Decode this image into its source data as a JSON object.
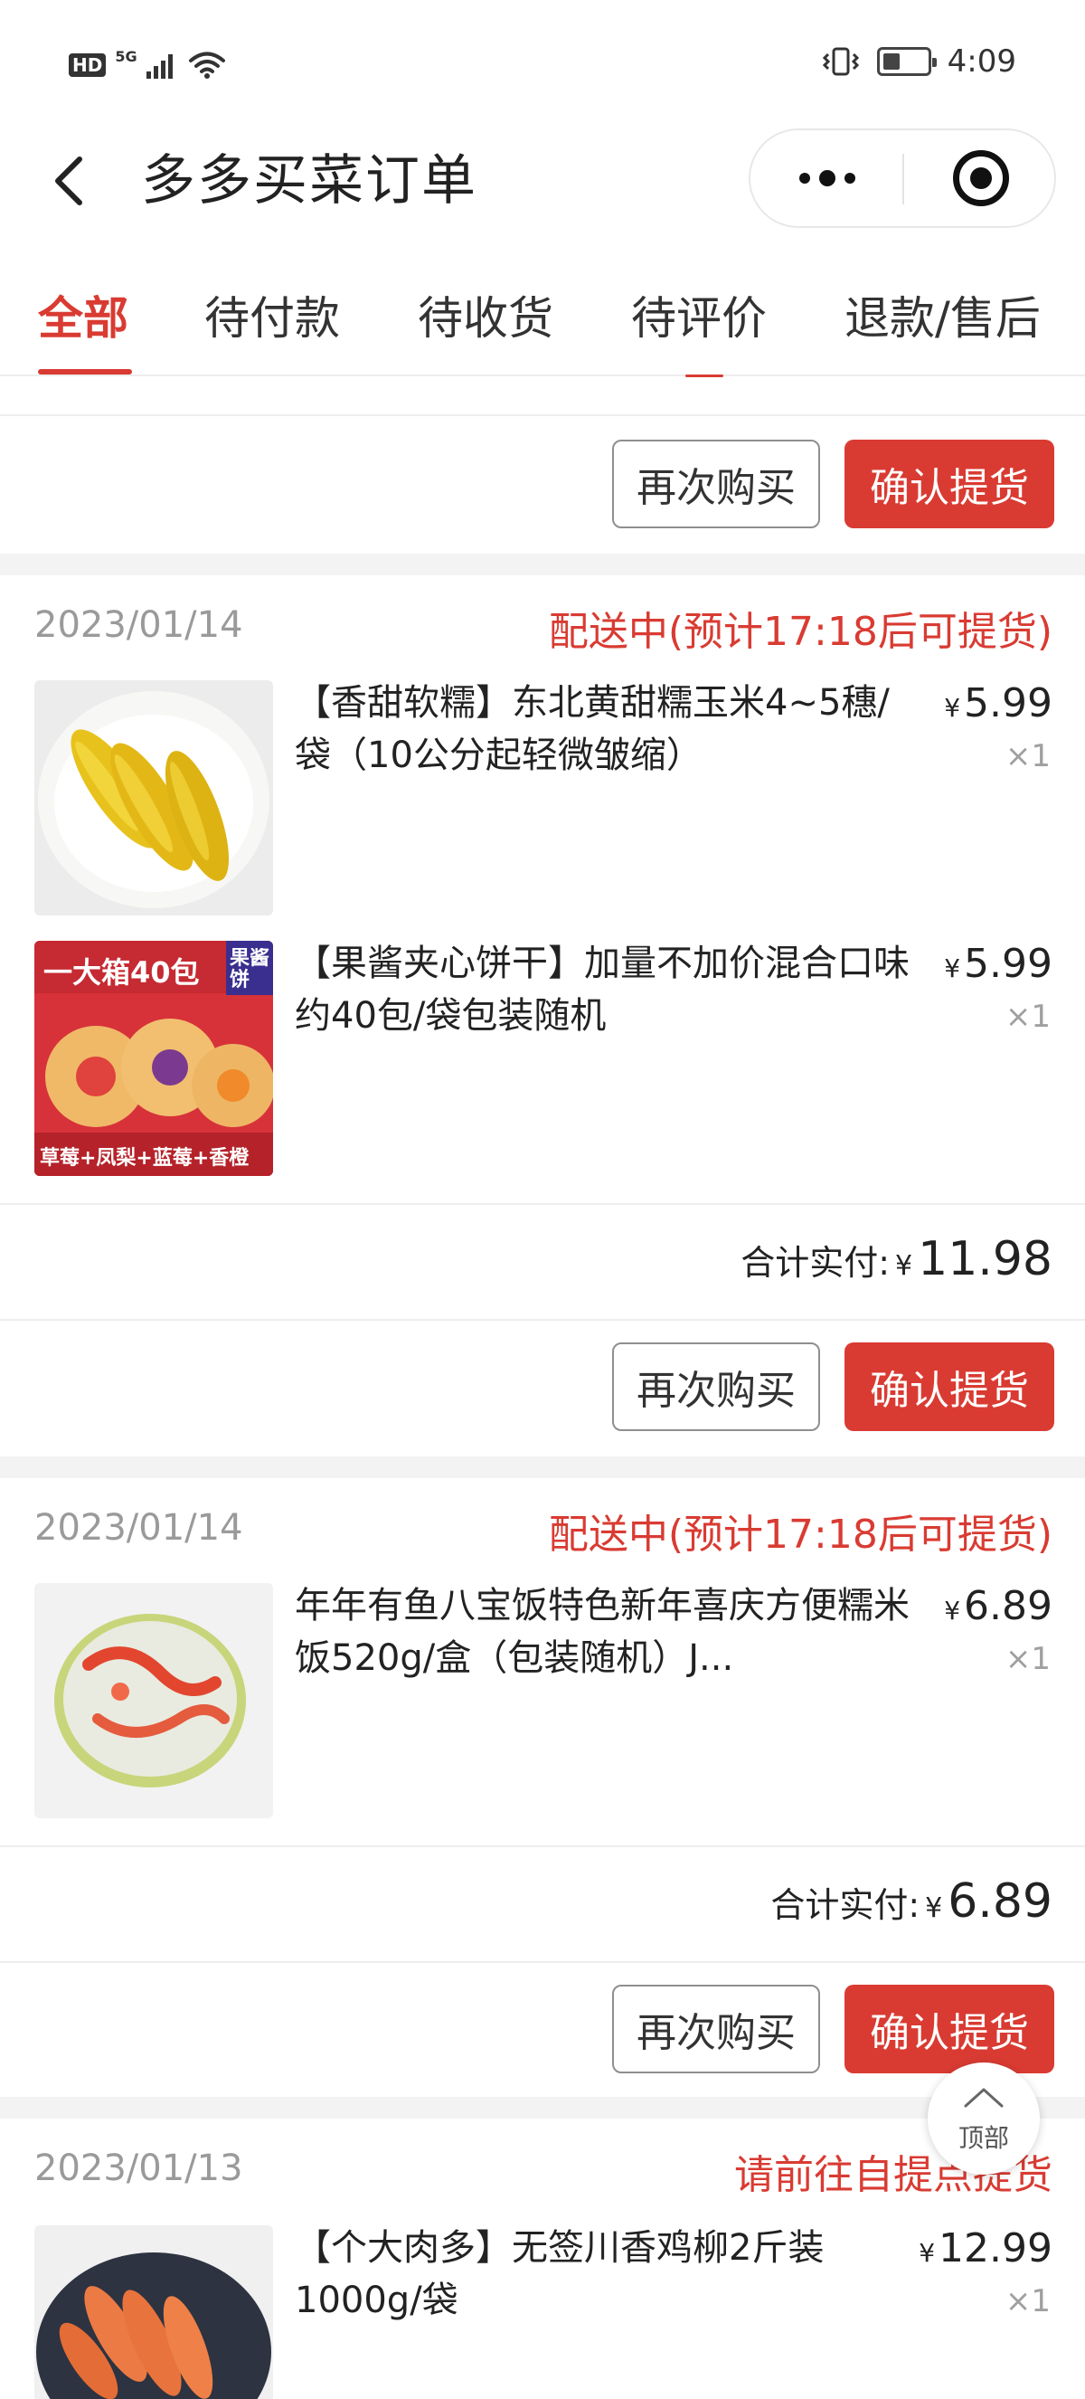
{
  "status_bar": {
    "network_hd": "HD",
    "network_5g": "5G",
    "time": "4:09",
    "battery_percent": 40
  },
  "header": {
    "title": "多多买菜订单"
  },
  "tabs": [
    {
      "label": "全部",
      "active": true
    },
    {
      "label": "待付款",
      "active": false
    },
    {
      "label": "待收货",
      "active": false
    },
    {
      "label": "待评价",
      "active": false
    },
    {
      "label": "退款/售后",
      "active": false
    }
  ],
  "buttons": {
    "buy_again": "再次购买",
    "confirm_pickup": "确认提货"
  },
  "orders": [
    {
      "date": "2023/01/14",
      "status": "配送中(预计17:18后可提货)",
      "items": [
        {
          "name": "【香甜软糯】东北黄甜糯玉米4~5穗/袋（10公分起轻微皱缩）",
          "price": "5.99",
          "qty": "×1",
          "icon": "corn-image"
        },
        {
          "name": "【果酱夹心饼干】加量不加价混合口味约40包/袋包装随机",
          "price": "5.99",
          "qty": "×1",
          "icon": "biscuit-box-image",
          "image_text": [
            "一大箱40包",
            "果酱饼",
            "草莓+凤梨+蓝莓+香橙"
          ]
        }
      ],
      "total_label": "合计实付:",
      "currency": "¥",
      "total": "11.98"
    },
    {
      "date": "2023/01/14",
      "status": "配送中(预计17:18后可提货)",
      "items": [
        {
          "name": "年年有鱼八宝饭特色新年喜庆方便糯米饭520g/盒（包装随机）J...",
          "price": "6.89",
          "qty": "×1",
          "icon": "rice-cake-image"
        }
      ],
      "total_label": "合计实付:",
      "currency": "¥",
      "total": "6.89"
    },
    {
      "date": "2023/01/13",
      "status": "请前往自提点提货",
      "items": [
        {
          "name": "【个大肉多】无签川香鸡柳2斤装1000g/袋",
          "price": "12.99",
          "qty": "×1",
          "icon": "chicken-strips-image"
        }
      ]
    }
  ],
  "currency_symbol": "¥",
  "back_to_top": "顶部",
  "colors": {
    "accent": "#d93b32",
    "muted": "#9a9a9a",
    "divider": "#f3f3f3"
  }
}
